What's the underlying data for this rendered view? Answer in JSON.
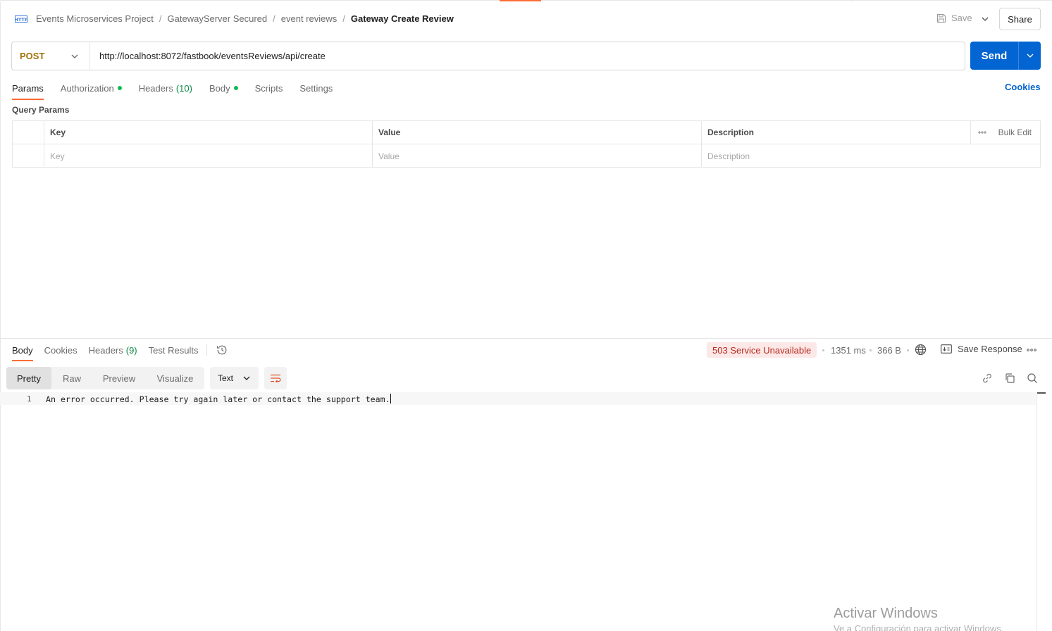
{
  "header": {
    "breadcrumb": [
      "Events Microservices Project",
      "GatewayServer Secured",
      "event reviews"
    ],
    "current": "Gateway Create Review",
    "save_label": "Save",
    "share_label": "Share"
  },
  "request": {
    "method": "POST",
    "url": "http://localhost:8072/fastbook/eventsReviews/api/create",
    "send_label": "Send"
  },
  "req_tabs": {
    "params": "Params",
    "authorization": "Authorization",
    "headers": "Headers",
    "headers_count": "(10)",
    "body": "Body",
    "scripts": "Scripts",
    "settings": "Settings"
  },
  "cookies_label": "Cookies",
  "query_params": {
    "title": "Query Params",
    "columns": {
      "key": "Key",
      "value": "Value",
      "description": "Description",
      "bulk_edit": "Bulk Edit"
    },
    "placeholders": {
      "key": "Key",
      "value": "Value",
      "description": "Description"
    }
  },
  "response": {
    "tabs": {
      "body": "Body",
      "cookies": "Cookies",
      "headers": "Headers",
      "headers_count": "(9)",
      "test_results": "Test Results"
    },
    "status": "503 Service Unavailable",
    "time": "1351 ms",
    "size": "366 B",
    "save_response": "Save Response",
    "formats": {
      "pretty": "Pretty",
      "raw": "Raw",
      "preview": "Preview",
      "visualize": "Visualize"
    },
    "type_select": "Text",
    "line_number": "1",
    "body_text": "An error occurred. Please try again later or contact the support team."
  },
  "watermark": {
    "title": "Activar Windows",
    "subtitle": "Ve a Configuración para activar Windows."
  },
  "colors": {
    "accent": "#ff6c37",
    "send": "#0265d2",
    "method": "#a0730c",
    "status_error": "#b2271a",
    "status_dot": "#0cbb52"
  }
}
